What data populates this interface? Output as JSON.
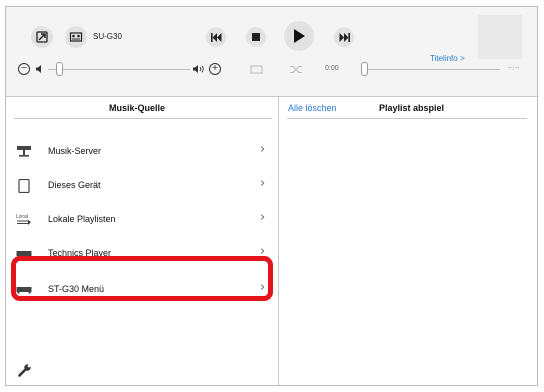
{
  "header": {
    "device_name": "SU-G30",
    "time_elapsed": "0:00",
    "time_total": "--:--",
    "titleinfo_label": "Titelinfo >",
    "volume_minus": "−",
    "volume_plus": "+"
  },
  "left": {
    "title": "Musik-Quelle",
    "items": [
      {
        "label": "Musik-Server",
        "icon": "server-icon"
      },
      {
        "label": "Dieses Gerät",
        "icon": "tablet-icon"
      },
      {
        "label": "Lokale Playlisten",
        "icon": "local-playlist-icon",
        "icon_text": "Local"
      },
      {
        "label": "Technics Player",
        "icon": "player-device-icon"
      },
      {
        "label": "ST-G30 Menü",
        "icon": "player-device-icon"
      }
    ]
  },
  "right": {
    "clear_all_label": "Alle löschen",
    "title": "Playlist abspiel"
  },
  "colors": {
    "accent": "#2b7bd6",
    "highlight": "#e5141b",
    "header_bg": "#f4f4f4"
  }
}
